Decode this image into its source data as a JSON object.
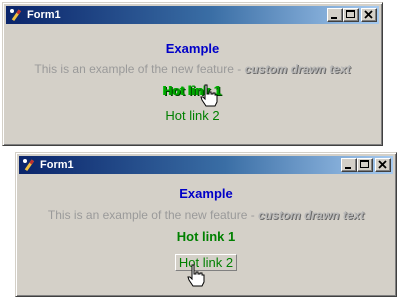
{
  "windows": [
    {
      "title": "Form1",
      "example_label": "Example",
      "description_prefix": "This is an example of the new feature - ",
      "description_custom": "custom drawn text",
      "hot_link_1": "Hot link 1",
      "hot_link_2": "Hot link 2",
      "hovered_link": "hot_link_1"
    },
    {
      "title": "Form1",
      "example_label": "Example",
      "description_prefix": "This is an example of the new feature - ",
      "description_custom": "custom drawn text",
      "hot_link_1": "Hot link 1",
      "hot_link_2": "Hot link 2",
      "hovered_link": "hot_link_2"
    }
  ],
  "icons": {
    "app": "form-app-icon",
    "minimize": "minimize-icon",
    "maximize": "maximize-icon",
    "close": "close-icon",
    "cursor": "hand-pointer-cursor-icon"
  },
  "colors": {
    "title_gradient_start": "#0a246a",
    "title_gradient_end": "#a6caf0",
    "window_face": "#d4d0c8",
    "example_text": "#0000c8",
    "link_text": "#008000",
    "description_text": "#9a9a9a"
  }
}
